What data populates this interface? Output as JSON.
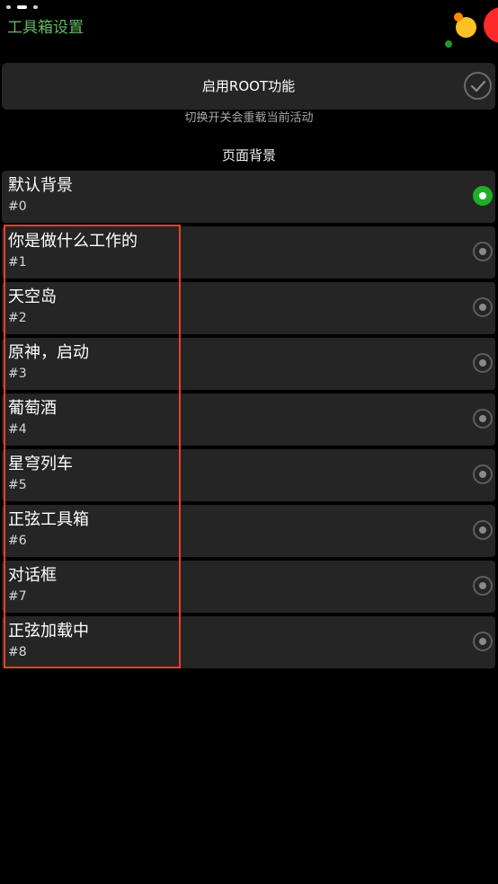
{
  "header": {
    "title": "工具箱设置"
  },
  "root_toggle": {
    "label": "启用ROOT功能",
    "checked": true,
    "hint": "切换开关会重载当前活动"
  },
  "background_section": {
    "title": "页面背景",
    "items": [
      {
        "name": "默认背景",
        "number": "#0",
        "selected": true
      },
      {
        "name": "你是做什么工作的",
        "number": "#1",
        "selected": false
      },
      {
        "name": "天空岛",
        "number": "#2",
        "selected": false
      },
      {
        "name": "原神，启动",
        "number": "#3",
        "selected": false
      },
      {
        "name": "葡萄酒",
        "number": "#4",
        "selected": false
      },
      {
        "name": "星穹列车",
        "number": "#5",
        "selected": false
      },
      {
        "name": "正弦工具箱",
        "number": "#6",
        "selected": false
      },
      {
        "name": "对话框",
        "number": "#7",
        "selected": false
      },
      {
        "name": "正弦加载中",
        "number": "#8",
        "selected": false
      }
    ]
  },
  "colors": {
    "title_green": "#64b964",
    "selected_green": "#1fae27",
    "highlight_red": "#e8412b",
    "card_bg": "#252525"
  }
}
